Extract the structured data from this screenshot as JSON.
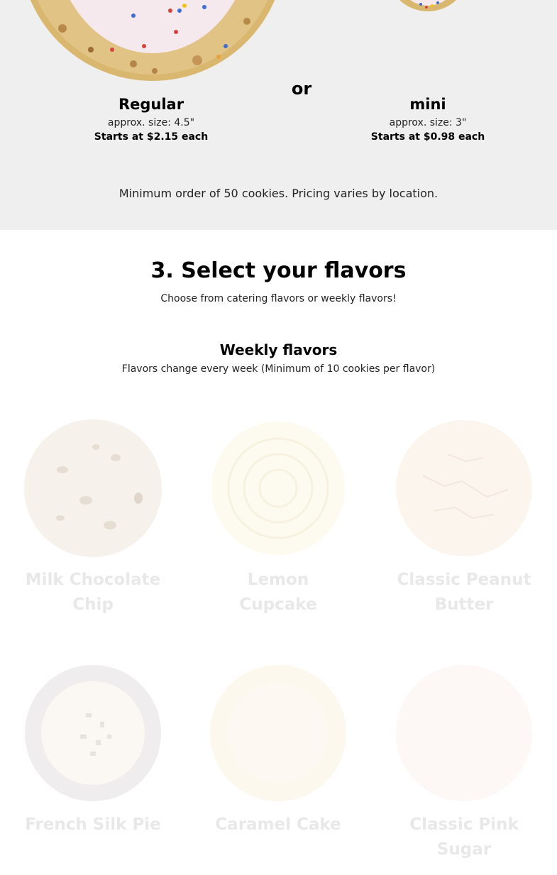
{
  "size_options": {
    "regular": {
      "name": "Regular",
      "approx_size": "approx. size: 4.5\"",
      "price": "Starts at $2.15 each"
    },
    "separator": "or",
    "mini": {
      "name": "mini",
      "approx_size": "approx. size: 3\"",
      "price": "Starts at $0.98 each"
    },
    "minimum_note": "Minimum order of 50 cookies. Pricing varies by location."
  },
  "flavors_section": {
    "title": "3. Select your flavors",
    "subtitle": "Choose from catering flavors or weekly flavors!",
    "weekly": {
      "title": "Weekly flavors",
      "subtitle": "Flavors change every week (Minimum of 10 cookies per flavor)"
    },
    "items": [
      {
        "name": "Milk Chocolate Chip",
        "icon": "milk-chocolate-chip-cookie-image"
      },
      {
        "name": "Lemon Cupcake",
        "icon": "lemon-cupcake-cookie-image"
      },
      {
        "name": "Classic Peanut Butter",
        "icon": "peanut-butter-cookie-image"
      },
      {
        "name": "French Silk Pie",
        "icon": "french-silk-pie-cookie-image"
      },
      {
        "name": "Caramel Cake",
        "icon": "caramel-cake-cookie-image"
      },
      {
        "name": "Classic Pink Sugar",
        "icon": "pink-sugar-cookie-image"
      }
    ]
  },
  "colors": {
    "gray_band": "#efefef",
    "faded_label": "#e8e8e8",
    "pink_frosting": "#f6e9ee",
    "cookie_dough": "#d9b76f"
  }
}
